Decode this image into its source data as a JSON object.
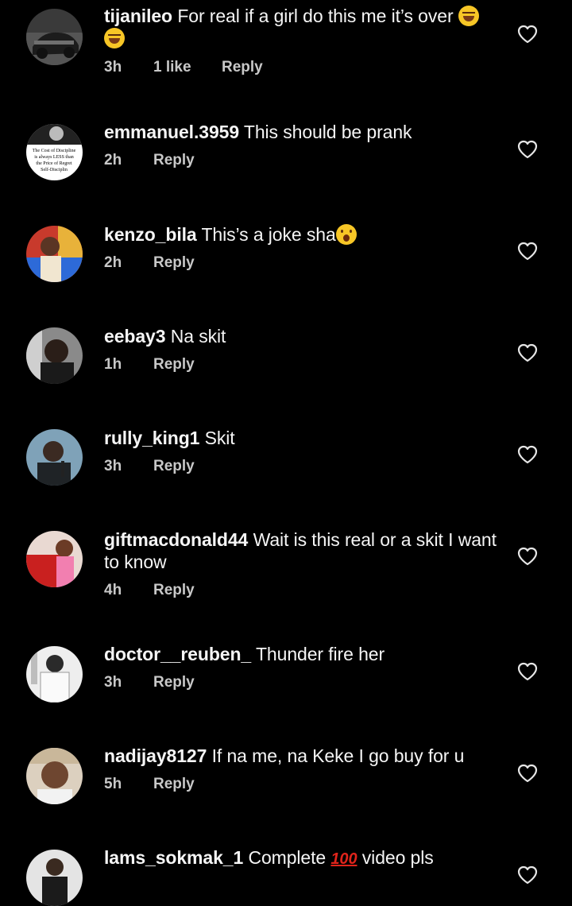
{
  "comments": [
    {
      "username": "tijanileo",
      "text": "For real if a girl do this me it’s over",
      "emoji": "laugh2",
      "time": "3h",
      "likes": "1 like",
      "reply": "Reply",
      "avatar": "car-photo"
    },
    {
      "username": "emmanuel.3959",
      "text": "This should be prank",
      "time": "2h",
      "reply": "Reply",
      "avatar": "quote-card",
      "avatar_text": [
        "The Cost of Discipline",
        "is always LESS than",
        "the Price of Regret",
        "Self-Disciplin"
      ]
    },
    {
      "username": "kenzo_bila",
      "text": "This’s a joke sha",
      "emoji": "wow",
      "time": "2h",
      "reply": "Reply",
      "avatar": "colorful-photo"
    },
    {
      "username": "eebay3",
      "text": "Na skit",
      "time": "1h",
      "reply": "Reply",
      "avatar": "man-photo"
    },
    {
      "username": "rully_king1",
      "text": "Skit",
      "time": "3h",
      "reply": "Reply",
      "avatar": "speaker-photo"
    },
    {
      "username": "giftmacdonald44",
      "text": "Wait is this real or a skit I want to know",
      "time": "4h",
      "reply": "Reply",
      "avatar": "woman-car-photo"
    },
    {
      "username": "doctor__reuben_",
      "text": "Thunder fire her",
      "time": "3h",
      "reply": "Reply",
      "avatar": "bw-photo"
    },
    {
      "username": "nadijay8127",
      "text": "If na me, na Keke I go buy for u",
      "time": "5h",
      "reply": "Reply",
      "avatar": "selfie-photo"
    },
    {
      "username": "lams_sokmak_1",
      "text_before": "Complete",
      "hundred": "100",
      "text_after": "video pls",
      "avatar": "suit-photo"
    }
  ],
  "colors": {
    "background": "#000000",
    "text": "#f5f5f5",
    "meta": "#c8c8c8"
  },
  "icons": {
    "like": "heart-outline-icon"
  }
}
